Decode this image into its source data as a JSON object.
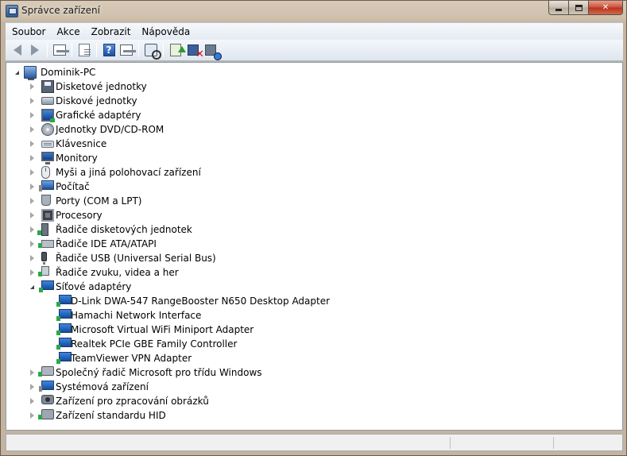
{
  "window": {
    "title": "Správce zařízení",
    "caption": {
      "minimize": "minimize",
      "maximize": "maximize",
      "close": "✕"
    }
  },
  "menu": [
    "Soubor",
    "Akce",
    "Zobrazit",
    "Nápověda"
  ],
  "toolbar": [
    {
      "name": "back-icon"
    },
    {
      "name": "forward-icon"
    },
    {
      "sep": true
    },
    {
      "name": "show-hide-console-tree-icon"
    },
    {
      "sep": true
    },
    {
      "name": "properties-icon"
    },
    {
      "sep": true
    },
    {
      "name": "help-icon"
    },
    {
      "name": "show-action-pane-icon"
    },
    {
      "sep": true
    },
    {
      "name": "scan-hardware-changes-icon"
    },
    {
      "sep": true
    },
    {
      "name": "update-driver-icon"
    },
    {
      "name": "uninstall-icon"
    },
    {
      "name": "disable-icon"
    }
  ],
  "tree": {
    "root": "Dominik-PC",
    "categories": [
      {
        "label": "Disketové jednotky",
        "icon": "i-floppy"
      },
      {
        "label": "Diskové jednotky",
        "icon": "i-disk"
      },
      {
        "label": "Grafické adaptéry",
        "icon": "i-display"
      },
      {
        "label": "Jednotky DVD/CD-ROM",
        "icon": "i-dvd"
      },
      {
        "label": "Klávesnice",
        "icon": "i-kbd"
      },
      {
        "label": "Monitory",
        "icon": "i-monitor"
      },
      {
        "label": "Myši a jiná polohovací zařízení",
        "icon": "i-mouse"
      },
      {
        "label": "Počítač",
        "icon": "i-comp"
      },
      {
        "label": "Porty (COM a LPT)",
        "icon": "i-port"
      },
      {
        "label": "Procesory",
        "icon": "i-cpu"
      },
      {
        "label": "Řadiče disketových jednotek",
        "icon": "i-fdc"
      },
      {
        "label": "Řadiče IDE ATA/ATAPI",
        "icon": "i-ide"
      },
      {
        "label": "Řadiče USB (Universal Serial Bus)",
        "icon": "i-usb"
      },
      {
        "label": "Řadiče zvuku, videa a her",
        "icon": "i-sound"
      },
      {
        "label": "Síťové adaptéry",
        "icon": "i-net",
        "expanded": true,
        "children": [
          "D-Link DWA-547 RangeBooster N650 Desktop Adapter",
          "Hamachi Network Interface",
          "Microsoft Virtual WiFi Miniport Adapter",
          "Realtek PCIe GBE Family Controller",
          "TeamViewer VPN Adapter"
        ]
      },
      {
        "label": "Společný řadič Microsoft pro třídu Windows",
        "icon": "i-smb"
      },
      {
        "label": "Systémová zařízení",
        "icon": "i-sys"
      },
      {
        "label": "Zařízení pro zpracování obrázků",
        "icon": "i-img"
      },
      {
        "label": "Zařízení standardu HID",
        "icon": "i-hid"
      }
    ]
  },
  "statusbar": {
    "segments": [
      "",
      "",
      ""
    ]
  }
}
